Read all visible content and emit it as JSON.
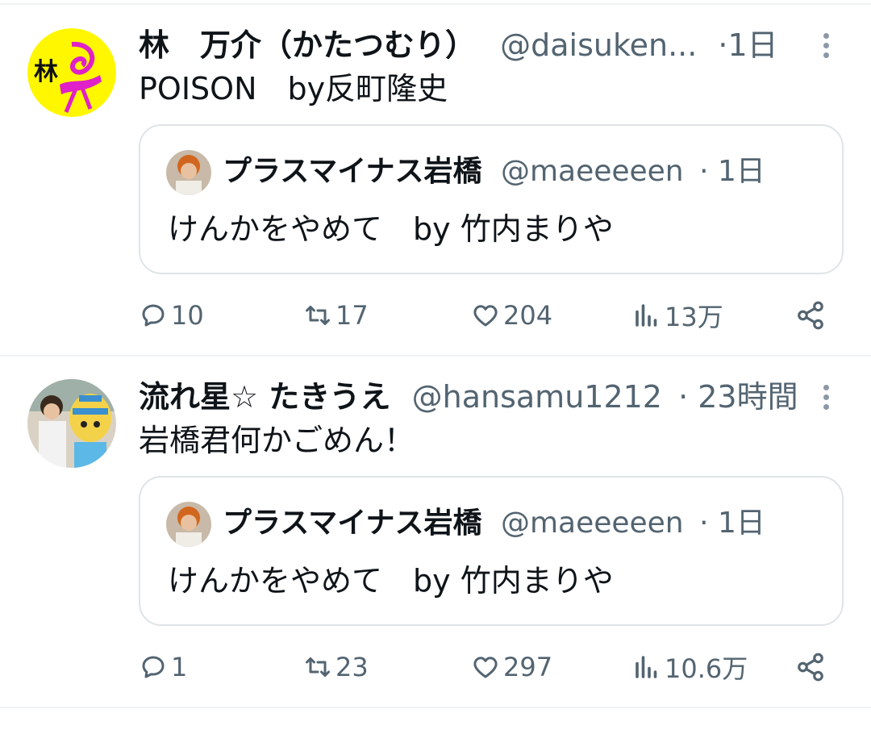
{
  "tweets": [
    {
      "name": "林　万介（かたつむり）",
      "handle": "@daisuken...",
      "time": "·1日",
      "avatar_text": "林",
      "text": "POISON　by反町隆史",
      "quote": {
        "name": "プラスマイナス岩橋",
        "handle": "@maeeeeen",
        "time": "· 1日",
        "text": "けんかをやめて　by 竹内まりや"
      },
      "stats": {
        "replies": "10",
        "retweets": "17",
        "likes": "204",
        "views": "13万"
      }
    },
    {
      "name": "流れ星☆ たきうえ",
      "handle": "@hansamu1212",
      "time": "· 23時間",
      "text": "岩橋君何かごめん！",
      "quote": {
        "name": "プラスマイナス岩橋",
        "handle": "@maeeeeen",
        "time": "· 1日",
        "text": "けんかをやめて　by 竹内まりや"
      },
      "stats": {
        "replies": "1",
        "retweets": "23",
        "likes": "297",
        "views": "10.6万"
      }
    }
  ],
  "colors": {
    "text": "#0f1419",
    "secondary": "#536471",
    "border": "#dfe4e7",
    "divider": "#eff3f4"
  },
  "icons": [
    "reply-icon",
    "retweet-icon",
    "like-icon",
    "views-icon",
    "share-icon",
    "more-icon"
  ]
}
